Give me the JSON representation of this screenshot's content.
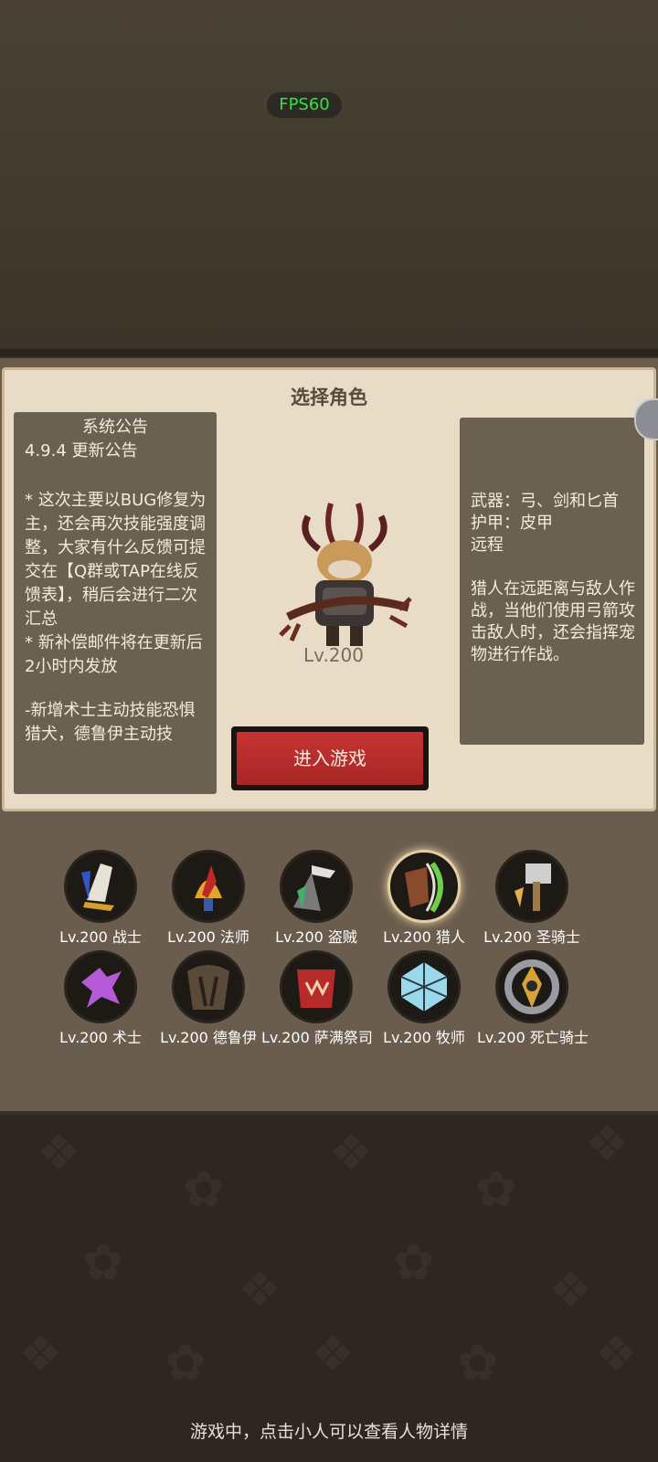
{
  "fps_label": "FPS60",
  "panel_title": "选择角色",
  "notice": {
    "title": "系统公告",
    "version_line": "4.9.4 更新公告",
    "paragraph1": "* 这次主要以BUG修复为主，还会再次技能强度调整，大家有什么反馈可提交在【Q群或TAP在线反馈表】，稍后会进行二次汇总",
    "paragraph2": "* 新补偿邮件将在更新后2小时内发放",
    "paragraph3": "-新增术士主动技能恐惧猎犬，德鲁伊主动技"
  },
  "selected": {
    "level": "Lv.200",
    "weapon": "武器：弓、剑和匕首",
    "armor": "护甲：皮甲",
    "range": "远程",
    "description": "猎人在远距离与敌人作战，当他们使用弓箭攻击敌人时，还会指挥宠物进行作战。"
  },
  "enter_button": "进入游戏",
  "classes": [
    {
      "label": "Lv.200 战士",
      "icon": "warrior-icon"
    },
    {
      "label": "Lv.200 法师",
      "icon": "mage-icon"
    },
    {
      "label": "Lv.200 盗贼",
      "icon": "rogue-icon"
    },
    {
      "label": "Lv.200 猎人",
      "icon": "hunter-icon",
      "selected": true
    },
    {
      "label": "Lv.200 圣骑士",
      "icon": "paladin-icon"
    },
    {
      "label": "Lv.200 术士",
      "icon": "warlock-icon"
    },
    {
      "label": "Lv.200 德鲁伊",
      "icon": "druid-icon"
    },
    {
      "label": "Lv.200 萨满祭司",
      "icon": "shaman-icon"
    },
    {
      "label": "Lv.200 牧师",
      "icon": "priest-icon"
    },
    {
      "label": "Lv.200 死亡骑士",
      "icon": "death-knight-icon"
    }
  ],
  "hint": "游戏中，点击小人可以查看人物详情",
  "colors": {
    "accent_red": "#b52b2b",
    "parchment": "#e9dcc6",
    "panel": "#6b6150"
  }
}
